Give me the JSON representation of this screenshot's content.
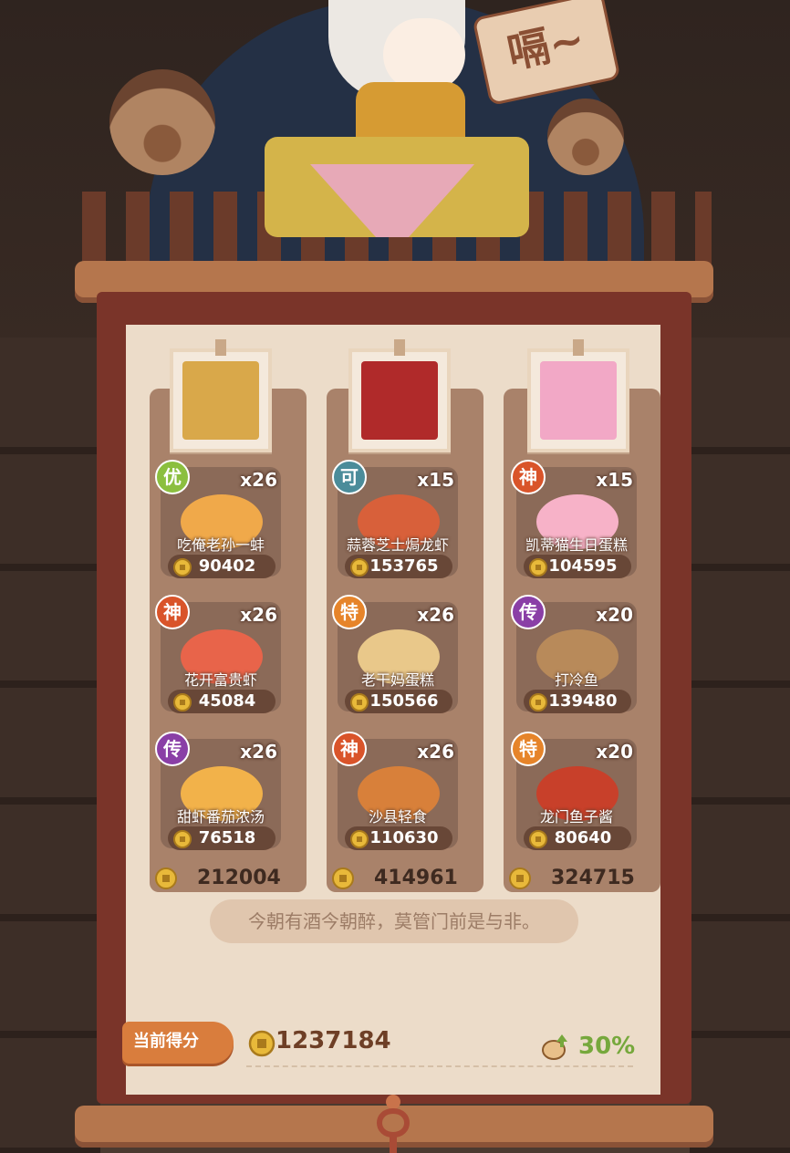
{
  "banner_sign": "嗝~",
  "columns": [
    {
      "portrait": "portrait-gold-crown",
      "portrait_color": "#d9a84a",
      "dishes": [
        {
          "grade": "优",
          "grade_color": "#8bbf3f",
          "count": "x26",
          "name": "吃俺老孙一蚌",
          "value": "90402",
          "dish_color": "#f0a94a"
        },
        {
          "grade": "神",
          "grade_color": "#d9542a",
          "count": "x26",
          "name": "花开富贵虾",
          "value": "45084",
          "dish_color": "#e8644a"
        },
        {
          "grade": "传",
          "grade_color": "#8a3fa6",
          "count": "x26",
          "name": "甜虾番茄浓汤",
          "value": "76518",
          "dish_color": "#f2b24a"
        }
      ],
      "total": "212004"
    },
    {
      "portrait": "portrait-red-hair",
      "portrait_color": "#b02a2a",
      "dishes": [
        {
          "grade": "可",
          "grade_color": "#4b8c9a",
          "count": "x15",
          "name": "蒜蓉芝士焗龙虾",
          "value": "153765",
          "dish_color": "#d8603a"
        },
        {
          "grade": "特",
          "grade_color": "#e6842a",
          "count": "x26",
          "name": "老干妈蛋糕",
          "value": "150566",
          "dish_color": "#e9c88a"
        },
        {
          "grade": "神",
          "grade_color": "#d9542a",
          "count": "x26",
          "name": "沙县轻食",
          "value": "110630",
          "dish_color": "#d8803a"
        }
      ],
      "total": "414961"
    },
    {
      "portrait": "portrait-pastel-girl",
      "portrait_color": "#f2a8c6",
      "dishes": [
        {
          "grade": "神",
          "grade_color": "#d9542a",
          "count": "x15",
          "name": "凯蒂猫生日蛋糕",
          "value": "104595",
          "dish_color": "#f7b2c8"
        },
        {
          "grade": "传",
          "grade_color": "#8a3fa6",
          "count": "x20",
          "name": "打冷鱼",
          "value": "139480",
          "dish_color": "#b88a5a"
        },
        {
          "grade": "特",
          "grade_color": "#e6842a",
          "count": "x20",
          "name": "龙门鱼子酱",
          "value": "80640",
          "dish_color": "#c8402a"
        }
      ],
      "total": "324715"
    }
  ],
  "quote": "今朝有酒今朝醉，莫管门前是与非。",
  "score": {
    "label": "当前得分",
    "value": "1237184",
    "bonus": "30%"
  },
  "colors": {
    "coin": "#e8b93a",
    "bonus": "#76a83c"
  }
}
